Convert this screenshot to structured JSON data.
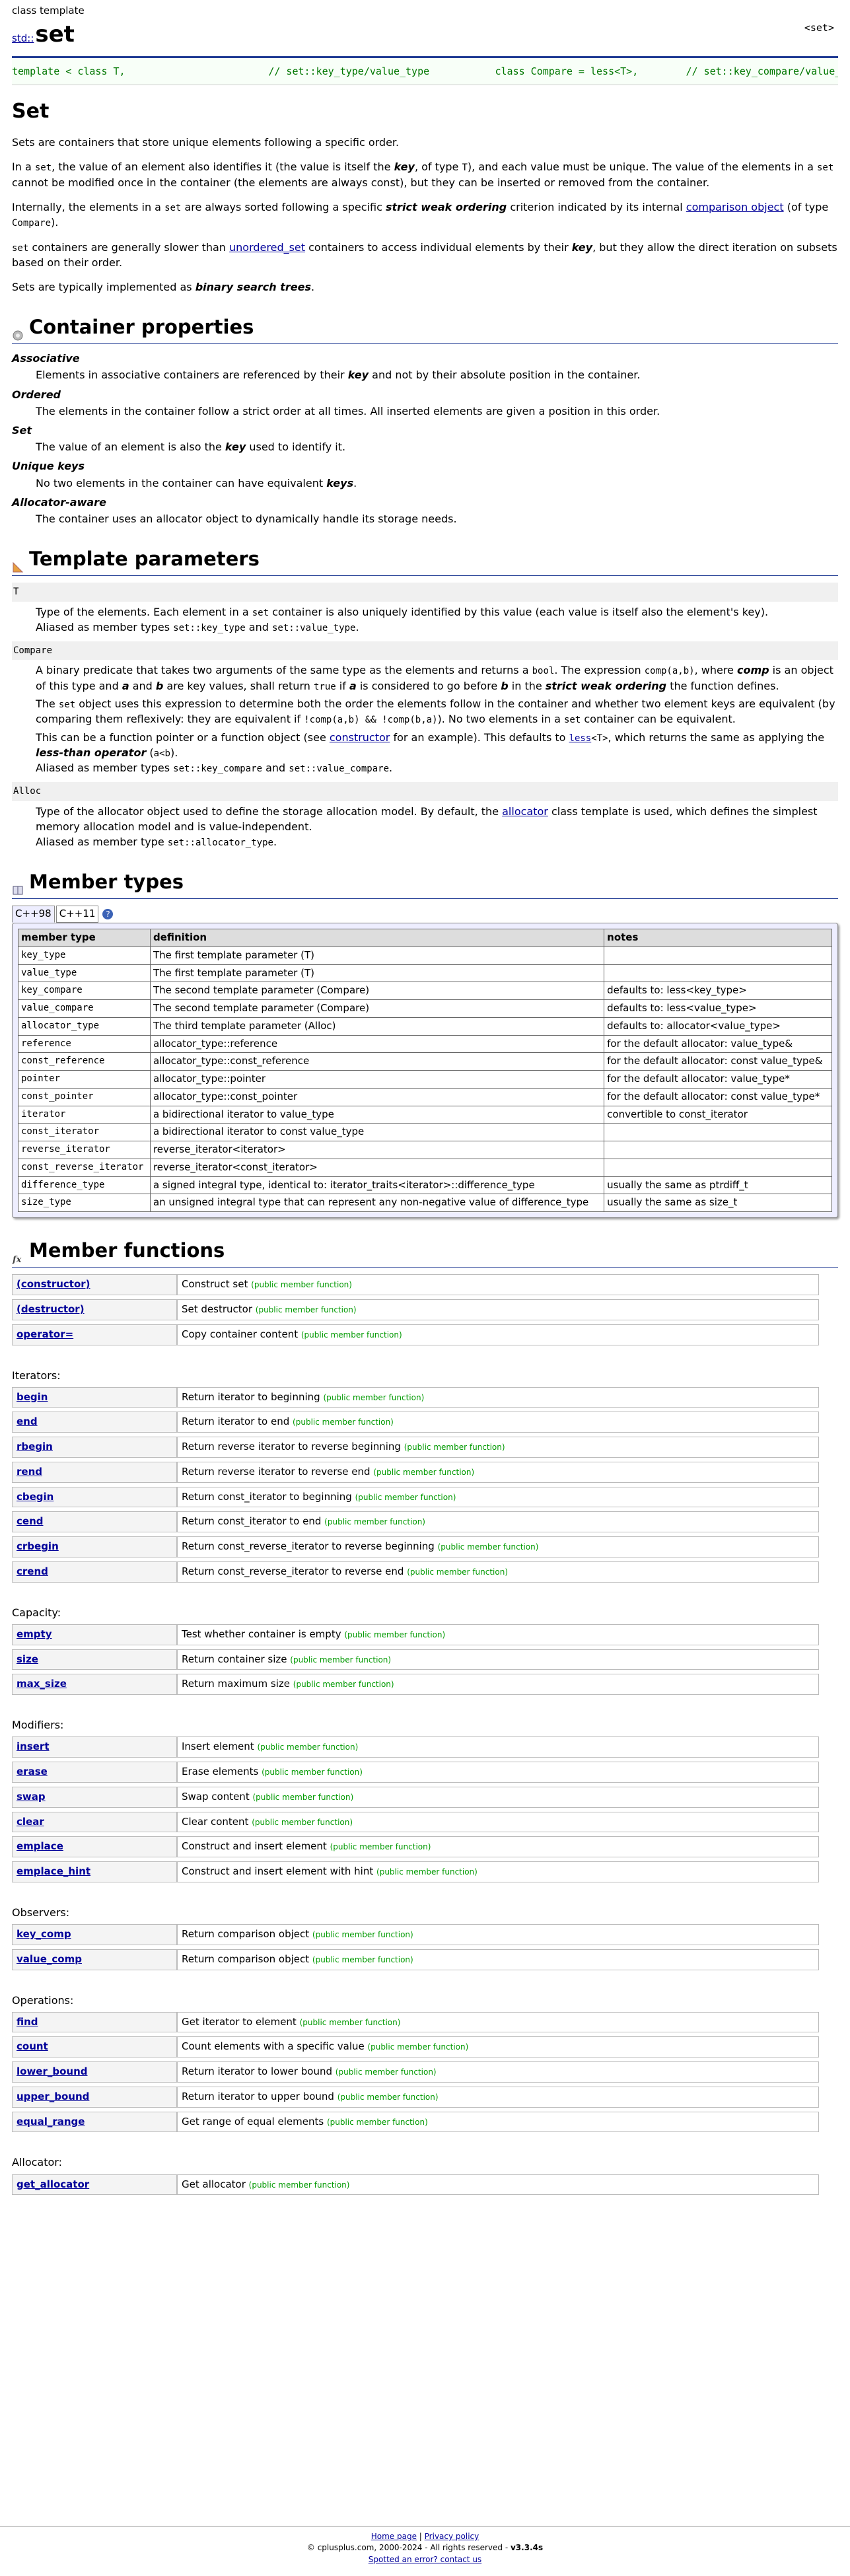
{
  "header": {
    "kind": "class template",
    "namespace": "std::",
    "name": "set",
    "header_file": "<set>",
    "declaration": "template < class T,                        // set::key_type/value_type           class Compare = less<T>,        // set::key_compare/value_compare           class Alloc = allocator<T>      // set::allocator_type           > class set;"
  },
  "intro": {
    "title": "Set",
    "p1": "Sets are containers that store unique elements following a specific order.",
    "p2a": "In a ",
    "p2_set": "set",
    "p2b": ", the value of an element also identifies it (the value is itself the ",
    "p2_key": "key",
    "p2c": ", of type ",
    "p2_T": "T",
    "p2d": "), and each value must be unique. The value of the elements in a ",
    "p2_set2": "set",
    "p2e": " cannot be modified once in the container (the elements are always const), but they can be inserted or removed from the container.",
    "p3a": "Internally, the elements in a ",
    "p3_set": "set",
    "p3b": " are always sorted following a specific ",
    "p3_swo": "strict weak ordering",
    "p3c": " criterion indicated by its internal ",
    "p3_link": "comparison object",
    "p3d": " (of type ",
    "p3_compare": "Compare",
    "p3e": ").",
    "p4_set": "set",
    "p4a": " containers are generally slower than ",
    "p4_link": "unordered_set",
    "p4b": " containers to access individual elements by their ",
    "p4_key": "key",
    "p4c": ", but they allow the direct iteration on subsets based on their order.",
    "p5a": "Sets are typically implemented as ",
    "p5_bst": "binary search trees",
    "p5b": "."
  },
  "container_properties": {
    "title": "Container properties",
    "assoc_term": "Associative",
    "assoc_a": "Elements in associative containers are referenced by their ",
    "assoc_key": "key",
    "assoc_b": " and not by their absolute position in the container.",
    "ordered_term": "Ordered",
    "ordered_desc": "The elements in the container follow a strict order at all times. All inserted elements are given a position in this order.",
    "set_term": "Set",
    "set_a": "The value of an element is also the ",
    "set_key": "key",
    "set_b": " used to identify it.",
    "unique_term": "Unique keys",
    "unique_a": "No two elements in the container can have equivalent ",
    "unique_keys": "keys",
    "unique_b": ".",
    "alloc_term": "Allocator-aware",
    "alloc_desc": "The container uses an allocator object to dynamically handle its storage needs."
  },
  "template_params": {
    "title": "Template parameters",
    "T_term": "T",
    "T_a": "Type of the elements. Each element in a ",
    "T_set": "set",
    "T_b": " container is also uniquely identified by this value (each value is itself also the element's key).",
    "T_c": "Aliased as member types ",
    "T_kt": "set::key_type",
    "T_and": " and ",
    "T_vt": "set::value_type",
    "T_end": ".",
    "C_term": "Compare",
    "C1a": "A binary predicate that takes two arguments of the same type as the elements and returns a ",
    "C1_bool": "bool",
    "C1b": ". The expression ",
    "C1_comp": "comp(a,b)",
    "C1c": ", where ",
    "C1_compw": "comp",
    "C1d": " is an object of this type and ",
    "C1_a": "a",
    "C1e": " and ",
    "C1_b": "b",
    "C1f": " are key values, shall return ",
    "C1_true": "true",
    "C1g": " if ",
    "C1_a2": "a",
    "C1h": " is considered to go before ",
    "C1_b2": "b",
    "C1i": " in the ",
    "C1_swo": "strict weak ordering",
    "C1j": " the function defines.",
    "C2a": "The ",
    "C2_set": "set",
    "C2b": " object uses this expression to determine both the order the elements follow in the container and whether two element keys are equivalent (by comparing them reflexively: they are equivalent if ",
    "C2_expr": "!comp(a,b) && !comp(b,a)",
    "C2c": "). No two elements in a ",
    "C2_set2": "set",
    "C2d": " container can be equivalent.",
    "C3a": "This can be a function pointer or a function object (see ",
    "C3_link": "constructor",
    "C3b": " for an example). This defaults to ",
    "C3_less": "less",
    "C3_lessT": "<T>",
    "C3c": ", which returns the same as applying the ",
    "C3_lt": "less-than operator",
    "C3d": " (",
    "C3_ab": "a<b",
    "C3e": ").",
    "C4a": "Aliased as member types ",
    "C4_kc": "set::key_compare",
    "C4_and": " and ",
    "C4_vc": "set::value_compare",
    "C4_end": ".",
    "A_term": "Alloc",
    "A1a": "Type of the allocator object used to define the storage allocation model. By default, the ",
    "A1_link": "allocator",
    "A1b": " class template is used, which defines the simplest memory allocation model and is value-independent.",
    "A2a": "Aliased as member type ",
    "A2_at": "set::allocator_type",
    "A2_end": "."
  },
  "member_types": {
    "title": "Member types",
    "tab1": "C++98",
    "tab2": "C++11",
    "help": "?",
    "headers": [
      "member type",
      "definition",
      "notes"
    ],
    "rows": [
      {
        "type": "key_type",
        "def": "The first template parameter (T)",
        "notes": ""
      },
      {
        "type": "value_type",
        "def": "The first template parameter (T)",
        "notes": ""
      },
      {
        "type": "key_compare",
        "def": "The second template parameter (Compare)",
        "notes": "defaults to: less<key_type>"
      },
      {
        "type": "value_compare",
        "def": "The second template parameter (Compare)",
        "notes": "defaults to: less<value_type>"
      },
      {
        "type": "allocator_type",
        "def": "The third template parameter (Alloc)",
        "notes": "defaults to: allocator<value_type>"
      },
      {
        "type": "reference",
        "def": "allocator_type::reference",
        "notes": "for the default allocator: value_type&"
      },
      {
        "type": "const_reference",
        "def": "allocator_type::const_reference",
        "notes": "for the default allocator: const value_type&"
      },
      {
        "type": "pointer",
        "def": "allocator_type::pointer",
        "notes": "for the default allocator: value_type*"
      },
      {
        "type": "const_pointer",
        "def": "allocator_type::const_pointer",
        "notes": "for the default allocator: const value_type*"
      },
      {
        "type": "iterator",
        "def": "a bidirectional iterator to value_type",
        "notes": "convertible to const_iterator"
      },
      {
        "type": "const_iterator",
        "def": "a bidirectional iterator to const value_type",
        "notes": ""
      },
      {
        "type": "reverse_iterator",
        "def": "reverse_iterator<iterator>",
        "notes": ""
      },
      {
        "type": "const_reverse_iterator",
        "def": "reverse_iterator<const_iterator>",
        "notes": ""
      },
      {
        "type": "difference_type",
        "def": "a signed integral type, identical to: iterator_traits<iterator>::difference_type",
        "notes": "usually the same as ptrdiff_t"
      },
      {
        "type": "size_type",
        "def": "an unsigned integral type that can represent any non-negative value of difference_type",
        "notes": "usually the same as size_t"
      }
    ]
  },
  "member_functions": {
    "title": "Member functions",
    "tag": "(public member function)",
    "groups": [
      {
        "title": "",
        "items": [
          {
            "name": "(constructor)",
            "desc": "Construct set"
          },
          {
            "name": "(destructor)",
            "desc": "Set destructor"
          },
          {
            "name": "operator=",
            "desc": "Copy container content"
          }
        ]
      },
      {
        "title": "Iterators",
        "items": [
          {
            "name": "begin",
            "desc": "Return iterator to beginning"
          },
          {
            "name": "end",
            "desc": "Return iterator to end"
          },
          {
            "name": "rbegin",
            "desc": "Return reverse iterator to reverse beginning"
          },
          {
            "name": "rend",
            "desc": "Return reverse iterator to reverse end"
          },
          {
            "name": "cbegin",
            "desc": "Return const_iterator to beginning"
          },
          {
            "name": "cend",
            "desc": "Return const_iterator to end"
          },
          {
            "name": "crbegin",
            "desc": "Return const_reverse_iterator to reverse beginning"
          },
          {
            "name": "crend",
            "desc": "Return const_reverse_iterator to reverse end"
          }
        ]
      },
      {
        "title": "Capacity",
        "items": [
          {
            "name": "empty",
            "desc": "Test whether container is empty"
          },
          {
            "name": "size",
            "desc": "Return container size"
          },
          {
            "name": "max_size",
            "desc": "Return maximum size"
          }
        ]
      },
      {
        "title": "Modifiers",
        "items": [
          {
            "name": "insert",
            "desc": "Insert element"
          },
          {
            "name": "erase",
            "desc": "Erase elements"
          },
          {
            "name": "swap",
            "desc": "Swap content"
          },
          {
            "name": "clear",
            "desc": "Clear content"
          },
          {
            "name": "emplace",
            "desc": "Construct and insert element"
          },
          {
            "name": "emplace_hint",
            "desc": "Construct and insert element with hint"
          }
        ]
      },
      {
        "title": "Observers",
        "items": [
          {
            "name": "key_comp",
            "desc": "Return comparison object"
          },
          {
            "name": "value_comp",
            "desc": "Return comparison object"
          }
        ]
      },
      {
        "title": "Operations",
        "items": [
          {
            "name": "find",
            "desc": "Get iterator to element"
          },
          {
            "name": "count",
            "desc": "Count elements with a specific value"
          },
          {
            "name": "lower_bound",
            "desc": "Return iterator to lower bound"
          },
          {
            "name": "upper_bound",
            "desc": "Return iterator to upper bound"
          },
          {
            "name": "equal_range",
            "desc": "Get range of equal elements"
          }
        ]
      },
      {
        "title": "Allocator",
        "items": [
          {
            "name": "get_allocator",
            "desc": "Get allocator"
          }
        ]
      }
    ]
  },
  "footer": {
    "home": "Home page",
    "sep": " | ",
    "privacy": "Privacy policy",
    "copyright": "© cplusplus.com, 2000-2024 - All rights reserved - ",
    "version": "v3.3.4s",
    "error": "Spotted an error? contact us"
  },
  "colors": {
    "accent": "#1f3a93",
    "link": "#000099",
    "decl": "#007700",
    "tag": "#009900"
  }
}
